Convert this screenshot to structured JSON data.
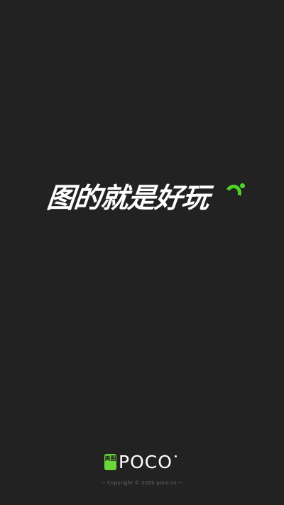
{
  "splash": {
    "slogan": "图的就是好玩",
    "accent_color": "#4fd12a",
    "background_color": "#222222"
  },
  "brand": {
    "badge_text": "美图",
    "wordmark": "POCO",
    "badge_color": "#6ad63a"
  },
  "footer": {
    "copyright": "-- Copyright © 2020 poco.cn --"
  }
}
